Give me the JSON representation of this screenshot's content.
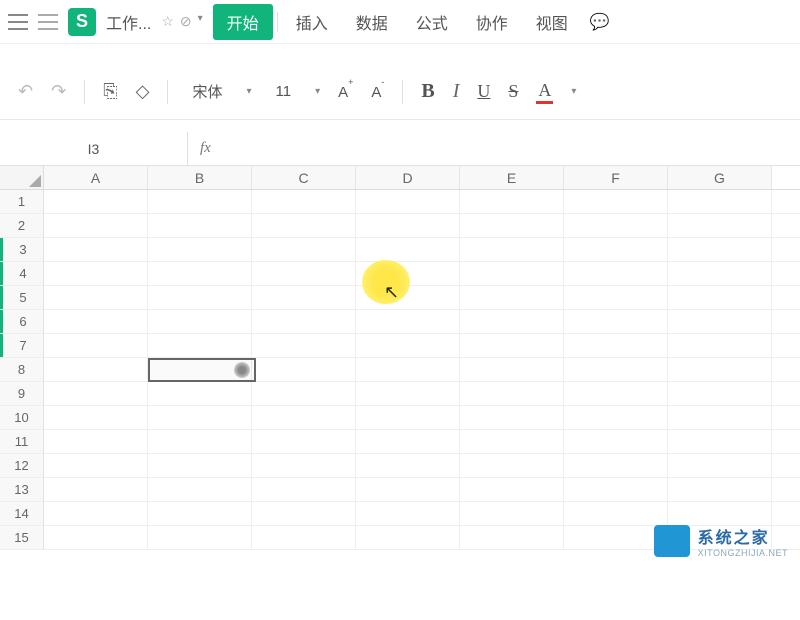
{
  "topbar": {
    "logo": "S",
    "doc_title": "工作..."
  },
  "menu": {
    "items": [
      "开始",
      "插入",
      "数据",
      "公式",
      "协作",
      "视图"
    ],
    "active_index": 0
  },
  "toolbar": {
    "font_name": "宋体",
    "font_size": "11",
    "inc_label": "A",
    "dec_label": "A",
    "bold": "B",
    "italic": "I",
    "underline": "U",
    "strike": "S",
    "color": "A"
  },
  "namebox": {
    "cell_ref": "I3",
    "fx": "fx"
  },
  "grid": {
    "columns": [
      "A",
      "B",
      "C",
      "D",
      "E",
      "F",
      "G"
    ],
    "row_count": 15,
    "selected_rows_start": 3,
    "selected_rows_end": 7,
    "selection_cell": "B8"
  },
  "watermark": {
    "title": "系统之家",
    "subtitle": "XITONGZHIJIA.NET"
  }
}
